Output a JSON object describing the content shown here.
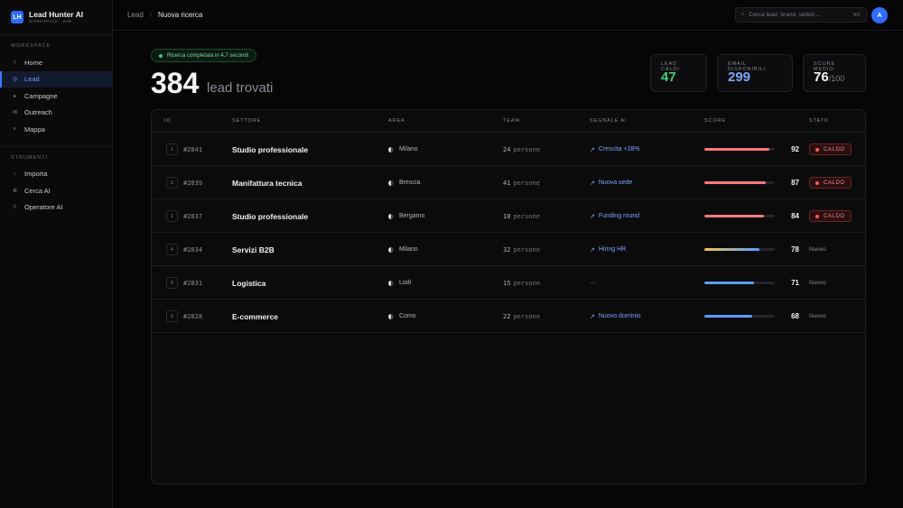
{
  "app": {
    "initials": "LH",
    "name": "Lead Hunter AI",
    "subtitle": "WORKSPACE · B2B"
  },
  "sidebar": {
    "workspace_label": "WORKSPACE",
    "workspace_items": [
      {
        "label": "Home",
        "icon": "home-icon",
        "glyph": "⌂",
        "active": false
      },
      {
        "label": "Lead",
        "icon": "target-icon",
        "glyph": "◎",
        "active": true
      },
      {
        "label": "Campagne",
        "icon": "megaphone-icon",
        "glyph": "▸",
        "active": false
      },
      {
        "label": "Outreach",
        "icon": "mail-icon",
        "glyph": "✉",
        "active": false
      },
      {
        "label": "Mappa",
        "icon": "map-icon",
        "glyph": "◐",
        "active": false
      }
    ],
    "tools_label": "STRUMENTI",
    "tools_items": [
      {
        "label": "Importa",
        "icon": "import-icon",
        "glyph": "↓",
        "active": false
      },
      {
        "label": "Cerca AI",
        "icon": "sparkle-icon",
        "glyph": "✲",
        "active": false
      },
      {
        "label": "Operatore AI",
        "icon": "bot-icon",
        "glyph": "◊",
        "active": false
      }
    ]
  },
  "topbar": {
    "breadcrumb_root": "Lead",
    "breadcrumb_sep": "/",
    "breadcrumb_current": "Nuova ricerca",
    "search_placeholder": "Cerca lead, brand, settori...",
    "search_shortcut": "⌘K",
    "avatar_initial": "A"
  },
  "results": {
    "status": "Ricerca completata in 4.7 secondi",
    "count": "384",
    "count_label": "lead trovati"
  },
  "stats": [
    {
      "label": "LEAD CALDI",
      "value": "47",
      "suffix": "",
      "color": "#3ecf75"
    },
    {
      "label": "EMAIL DISPONIBILI",
      "value": "299",
      "suffix": "",
      "color": "#78a6ff"
    },
    {
      "label": "SCORE MEDIO",
      "value": "76",
      "suffix": "/100",
      "color": "#f5f5f7"
    }
  ],
  "table": {
    "headers": [
      "ID",
      "SETTORE",
      "AREA",
      "TEAM",
      "SEGNALE AI",
      "SCORE",
      "STATO"
    ],
    "team_unit": "persone",
    "rows": [
      {
        "rank": "1",
        "id": "#2841",
        "sector": "Studio professionale",
        "area": "Milano",
        "team": "24",
        "signal": "Crescita +28%",
        "score": 92,
        "bar_color": "#ff7a7a",
        "status": "CALDO",
        "hot": true
      },
      {
        "rank": "2",
        "id": "#2839",
        "sector": "Manifattura tecnica",
        "area": "Brescia",
        "team": "41",
        "signal": "Nuova sede",
        "score": 87,
        "bar_color": "#ff7a7a",
        "status": "CALDO",
        "hot": true
      },
      {
        "rank": "1",
        "id": "#2837",
        "sector": "Studio professionale",
        "area": "Bergamo",
        "team": "18",
        "signal": "Funding round",
        "score": 84,
        "bar_color": "#ff7a7a",
        "status": "CALDO",
        "hot": true
      },
      {
        "rank": "4",
        "id": "#2834",
        "sector": "Servizi B2B",
        "area": "Milano",
        "team": "32",
        "signal": "Hiring HR",
        "score": 78,
        "bar_color": "gradient",
        "status": "Nuovo",
        "hot": false
      },
      {
        "rank": "5",
        "id": "#2831",
        "sector": "Logistica",
        "area": "Lodi",
        "team": "15",
        "signal": "—",
        "score": 71,
        "bar_color": "#5b9dff",
        "status": "Nuovo",
        "hot": false
      },
      {
        "rank": "6",
        "id": "#2828",
        "sector": "E-commerce",
        "area": "Como",
        "team": "22",
        "signal": "Nuovo dominio",
        "score": 68,
        "bar_color": "#5b9dff",
        "status": "Nuovo",
        "hot": false
      }
    ]
  }
}
